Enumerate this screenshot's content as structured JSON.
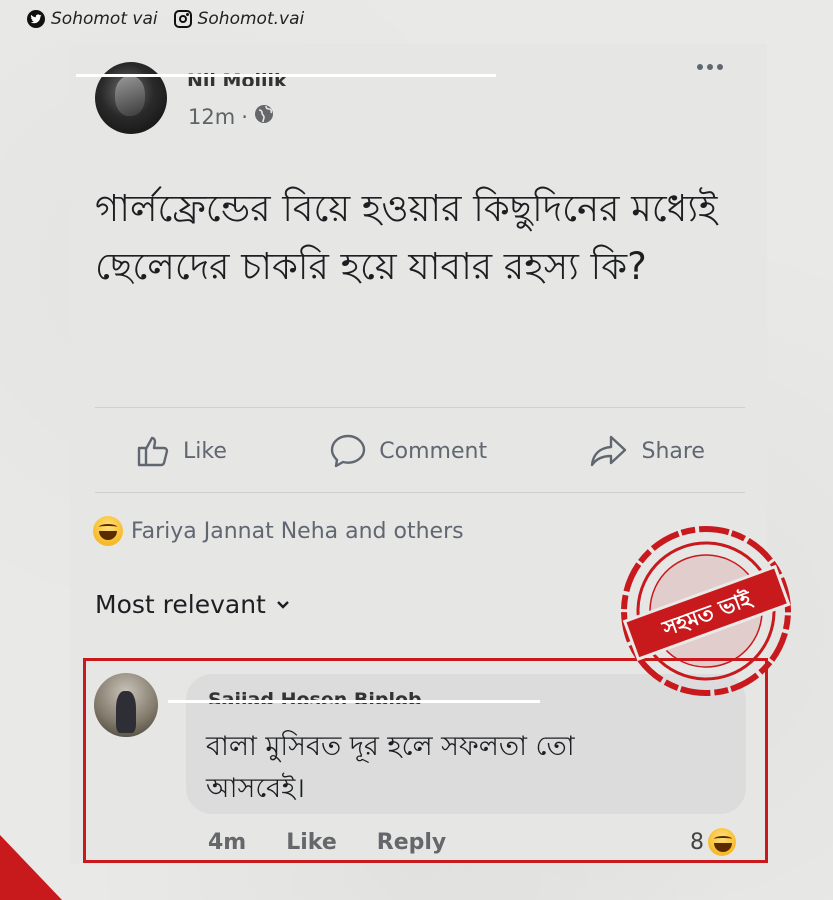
{
  "social": {
    "twitter_handle": "Sohomot vai",
    "instagram_handle": "Sohomot.vai"
  },
  "post": {
    "author": "Nil Mollik",
    "time": "12m",
    "privacy_separator": "·",
    "text": "গার্লফ্রেন্ডের বিয়ে হওয়ার কিছুদিনের মধ্যেই ছেলেদের চাকরি হয়ে যাবার রহস্য কি?"
  },
  "actions": {
    "like": "Like",
    "comment": "Comment",
    "share": "Share"
  },
  "reactions": {
    "summary": "Fariya Jannat Neha and others"
  },
  "sort": {
    "label": "Most relevant"
  },
  "comment": {
    "author": "Sajjad Hosen Biplob",
    "text": "বালা মুসিবত দূর হলে সফলতা তো আসবেই।",
    "time": "4m",
    "like": "Like",
    "reply": "Reply",
    "reaction_count": "8"
  },
  "stamp": {
    "text": "সহমত ভাই"
  },
  "colors": {
    "accent_red": "#c8191d",
    "background": "#e9e9e7",
    "icon_gray": "#606770"
  }
}
